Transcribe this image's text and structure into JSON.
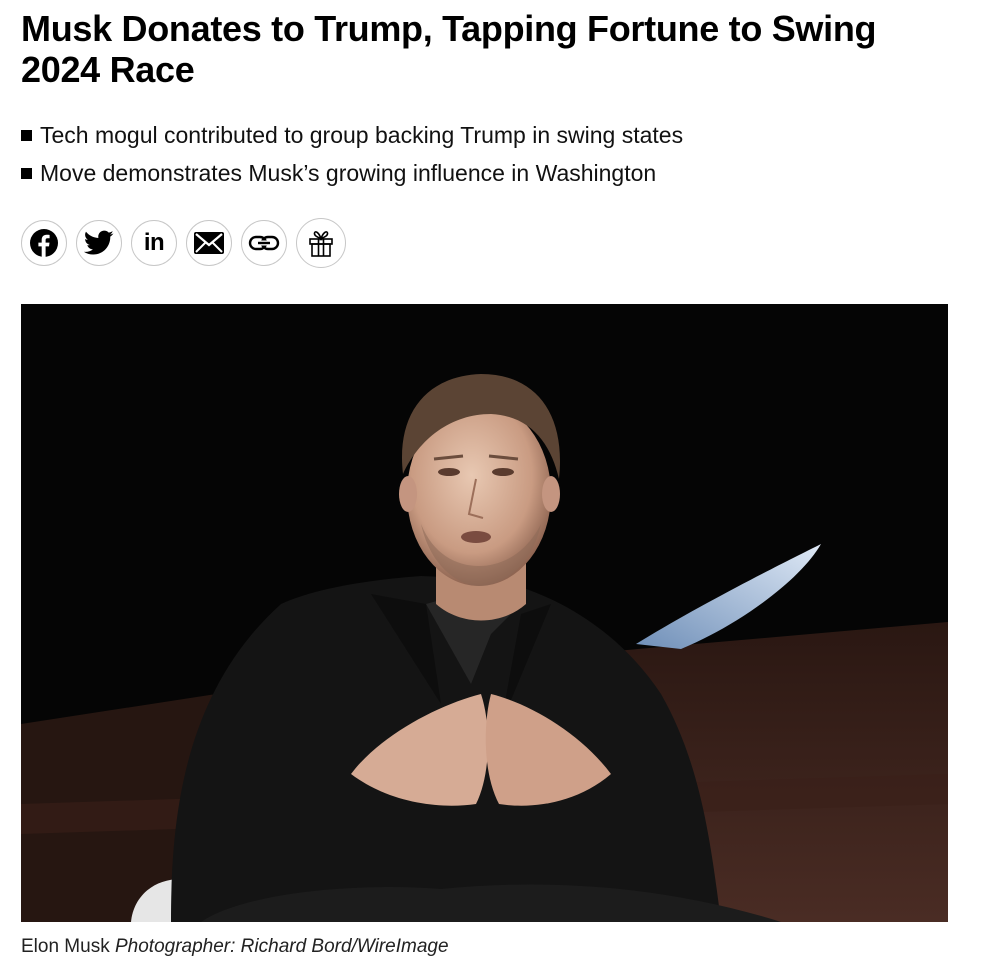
{
  "article": {
    "headline": "Musk Donates to Trump, Tapping Fortune to Swing 2024 Race",
    "bullets": [
      "Tech mogul contributed to group backing Trump in swing states",
      "Move demonstrates Musk’s growing influence in Washington"
    ],
    "share_buttons": [
      {
        "icon": "facebook-icon"
      },
      {
        "icon": "twitter-icon"
      },
      {
        "icon": "linkedin-icon",
        "glyph": "in"
      },
      {
        "icon": "email-icon"
      },
      {
        "icon": "link-icon"
      },
      {
        "icon": "gift-icon"
      }
    ],
    "image": {
      "subject": "Elon Musk",
      "credit": "Photographer: Richard Bord/WireImage"
    }
  },
  "colors": {
    "text": "#000000",
    "button_border": "#c7c7c7",
    "photo_background": "#070707"
  }
}
